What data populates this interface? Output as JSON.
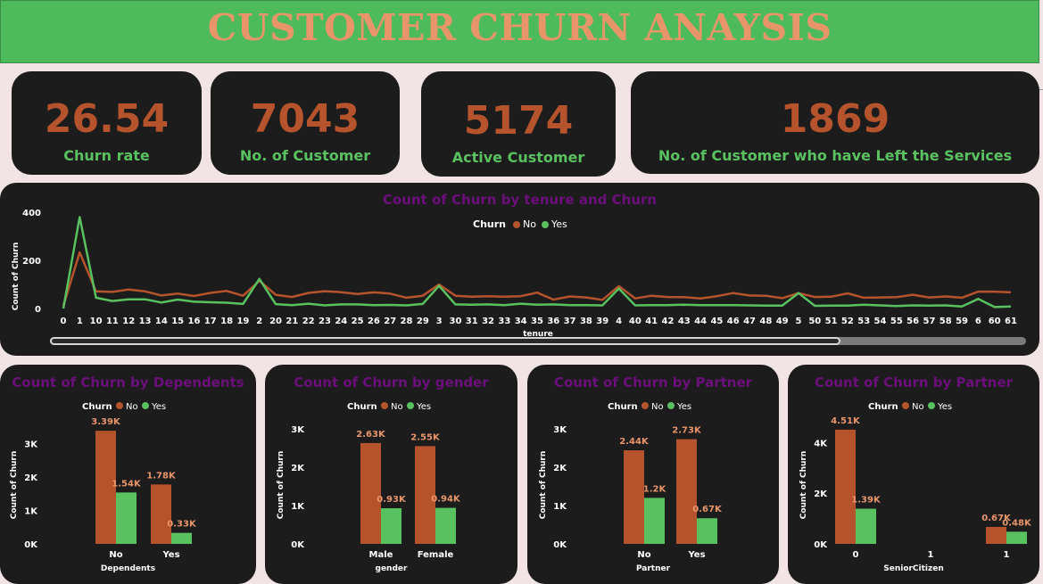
{
  "title": "CUSTOMER CHURN ANAYSIS",
  "colors": {
    "no": "#b5532c",
    "yes": "#59c15f",
    "title_purple": "#6b0f7a",
    "card_bg": "#1c1c1c"
  },
  "kpis": [
    {
      "value": "26.54",
      "label": "Churn  rate"
    },
    {
      "value": "7043",
      "label": "No. of Customer"
    },
    {
      "value": "5174",
      "label": "Active Customer"
    },
    {
      "value": "1869",
      "label": "No. of Customer who have Left the Services"
    }
  ],
  "legend": {
    "title": "Churn",
    "no": "No",
    "yes": "Yes"
  },
  "chart_data": [
    {
      "type": "line",
      "title": "Count of Churn by tenure and Churn",
      "xlabel": "tenure",
      "ylabel": "Count of Churn",
      "y_ticks": [
        "400",
        "200",
        "0"
      ],
      "ylim": [
        0,
        430
      ],
      "categories": [
        "0",
        "1",
        "10",
        "11",
        "12",
        "13",
        "14",
        "15",
        "16",
        "17",
        "18",
        "19",
        "2",
        "20",
        "21",
        "22",
        "23",
        "24",
        "25",
        "26",
        "27",
        "28",
        "29",
        "3",
        "30",
        "31",
        "32",
        "33",
        "34",
        "35",
        "36",
        "37",
        "38",
        "39",
        "4",
        "40",
        "41",
        "42",
        "43",
        "44",
        "45",
        "46",
        "47",
        "48",
        "49",
        "5",
        "50",
        "51",
        "52",
        "53",
        "54",
        "55",
        "56",
        "57",
        "58",
        "59",
        "6",
        "60",
        "61"
      ],
      "series": [
        {
          "name": "No",
          "values": [
            11,
            233,
            71,
            69,
            79,
            71,
            54,
            62,
            52,
            65,
            73,
            53,
            115,
            57,
            48,
            65,
            72,
            68,
            60,
            67,
            62,
            45,
            53,
            100,
            53,
            49,
            51,
            49,
            51,
            66,
            37,
            50,
            46,
            36,
            93,
            42,
            53,
            48,
            47,
            42,
            51,
            64,
            54,
            53,
            43,
            64,
            48,
            49,
            63,
            45,
            46,
            47,
            57,
            46,
            50,
            45,
            70,
            70,
            67
          ]
        },
        {
          "name": "Yes",
          "values": [
            0,
            380,
            45,
            31,
            38,
            38,
            25,
            37,
            28,
            26,
            24,
            19,
            123,
            18,
            14,
            20,
            13,
            17,
            17,
            14,
            15,
            13,
            19,
            94,
            17,
            16,
            17,
            14,
            20,
            16,
            17,
            14,
            14,
            13,
            83,
            13,
            14,
            14,
            16,
            14,
            14,
            14,
            13,
            12,
            12,
            64,
            11,
            12,
            12,
            16,
            13,
            10,
            13,
            12,
            13,
            8,
            40,
            6,
            8
          ]
        }
      ]
    },
    {
      "type": "bar",
      "title": "Count of Churn by Dependents",
      "xlabel": "Dependents",
      "ylabel": "Count of Churn",
      "y_ticks": [
        "3K",
        "2K",
        "1K",
        "0K"
      ],
      "ylim": [
        0,
        3500
      ],
      "categories": [
        "No",
        "Yes"
      ],
      "series": [
        {
          "name": "No",
          "values": [
            3390,
            1780
          ],
          "labels": [
            "3.39K",
            "1.78K"
          ]
        },
        {
          "name": "Yes",
          "values": [
            1540,
            330
          ],
          "labels": [
            "1.54K",
            "0.33K"
          ]
        }
      ]
    },
    {
      "type": "bar",
      "title": "Count of Churn by gender",
      "xlabel": "gender",
      "ylabel": "Count of Churn",
      "y_ticks": [
        "3K",
        "2K",
        "1K",
        "0K"
      ],
      "ylim": [
        0,
        3000
      ],
      "categories": [
        "Male",
        "Female"
      ],
      "series": [
        {
          "name": "No",
          "values": [
            2630,
            2550
          ],
          "labels": [
            "2.63K",
            "2.55K"
          ]
        },
        {
          "name": "Yes",
          "values": [
            930,
            940
          ],
          "labels": [
            "0.93K",
            "0.94K"
          ]
        }
      ]
    },
    {
      "type": "bar",
      "title": "Count of Churn by Partner",
      "xlabel": "Partner",
      "ylabel": "Count of Churn",
      "y_ticks": [
        "3K",
        "2K",
        "1K",
        "0K"
      ],
      "ylim": [
        0,
        3000
      ],
      "categories": [
        "No",
        "Yes"
      ],
      "series": [
        {
          "name": "No",
          "values": [
            2440,
            2730
          ],
          "labels": [
            "2.44K",
            "2.73K"
          ]
        },
        {
          "name": "Yes",
          "values": [
            1200,
            670
          ],
          "labels": [
            "1.2K",
            "0.67K"
          ]
        }
      ]
    },
    {
      "type": "bar",
      "title": "Count of Churn by Partner",
      "xlabel": "SeniorCitizen",
      "ylabel": "Count of Churn",
      "y_ticks": [
        "4K",
        "2K",
        "0K"
      ],
      "ylim": [
        0,
        5000
      ],
      "categories": [
        "0",
        "1",
        "1"
      ],
      "series": [
        {
          "name": "No",
          "values": [
            4510,
            0,
            670
          ],
          "labels": [
            "4.51K",
            "",
            "0.67K"
          ]
        },
        {
          "name": "Yes",
          "values": [
            1390,
            0,
            480
          ],
          "labels": [
            "1.39K",
            "",
            "0.48K"
          ]
        }
      ]
    }
  ]
}
